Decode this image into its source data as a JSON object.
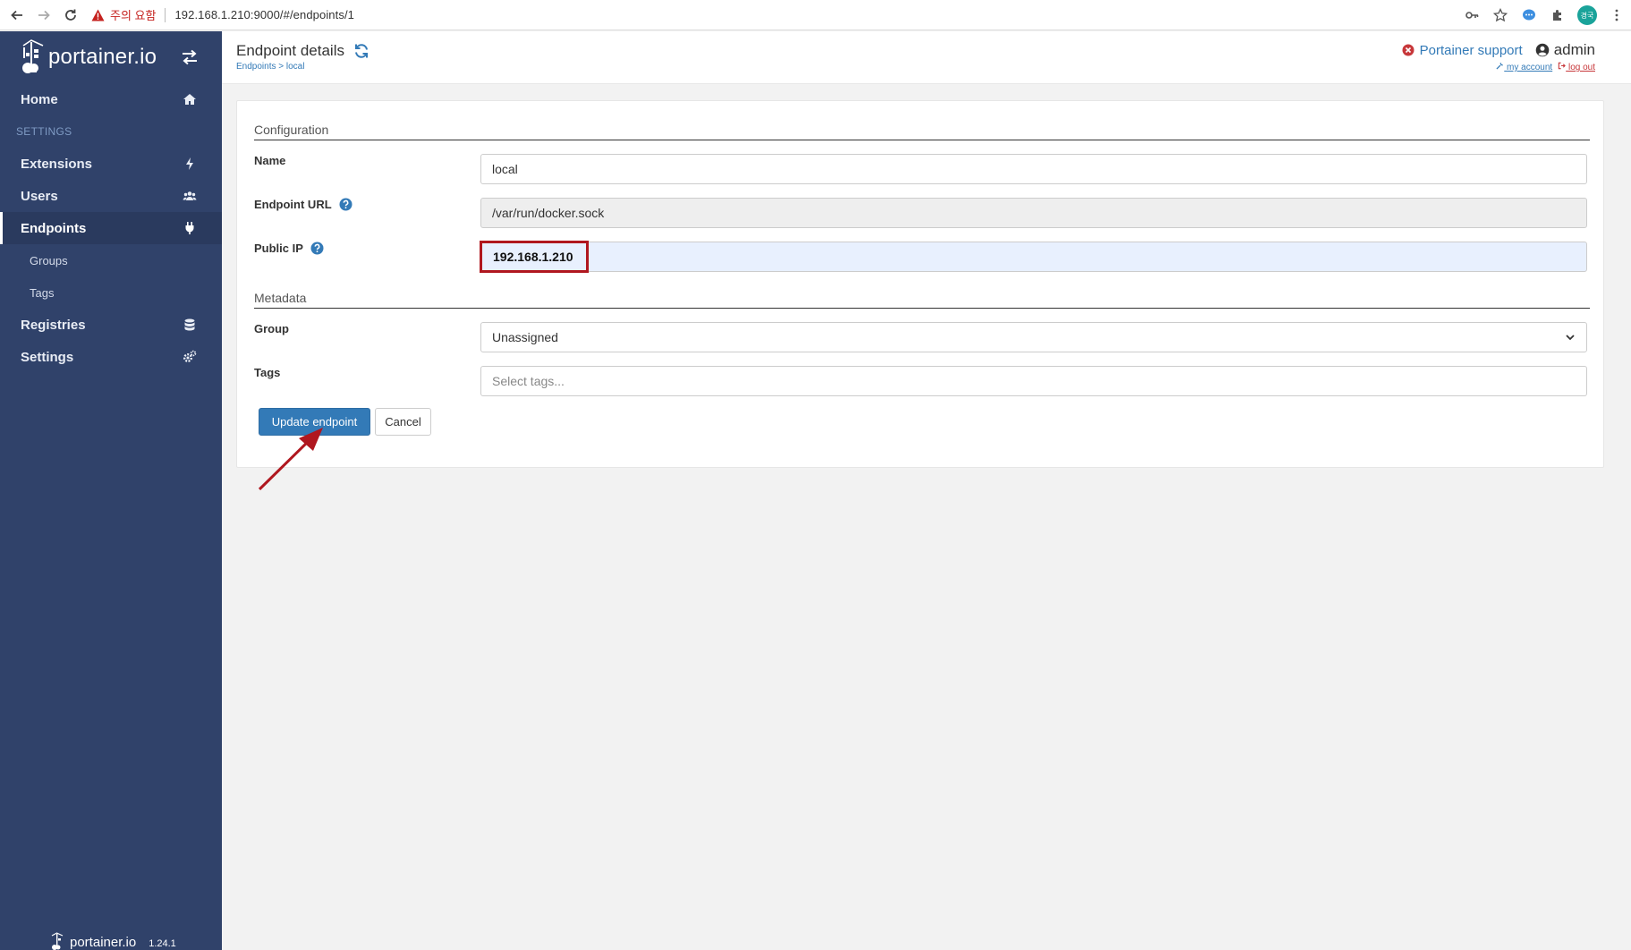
{
  "browser": {
    "warning_text": "주의 요함",
    "url": "192.168.1.210:9000/#/endpoints/1",
    "profile_initials": "경국"
  },
  "sidebar": {
    "logo_text": "portainer.io",
    "items": [
      {
        "label": "Home",
        "icon": "home-icon"
      },
      {
        "label": "Extensions",
        "icon": "bolt-icon"
      },
      {
        "label": "Users",
        "icon": "users-icon"
      },
      {
        "label": "Endpoints",
        "icon": "plug-icon"
      },
      {
        "label": "Registries",
        "icon": "database-icon"
      },
      {
        "label": "Settings",
        "icon": "cogs-icon"
      }
    ],
    "section_settings": "SETTINGS",
    "sub_items": [
      {
        "label": "Groups"
      },
      {
        "label": "Tags"
      }
    ],
    "footer_logo": "portainer.io",
    "version": "1.24.1"
  },
  "header": {
    "title": "Endpoint details",
    "breadcrumb_link": "Endpoints",
    "breadcrumb_sep": " > ",
    "breadcrumb_current": "local",
    "support_label": "Portainer support",
    "user": "admin",
    "my_account": "my account",
    "log_out": "log out"
  },
  "form": {
    "section_configuration": "Configuration",
    "name_label": "Name",
    "name_value": "local",
    "url_label": "Endpoint URL",
    "url_value": "/var/run/docker.sock",
    "public_ip_label": "Public IP",
    "public_ip_value": "192.168.1.210",
    "section_metadata": "Metadata",
    "group_label": "Group",
    "group_value": "Unassigned",
    "tags_label": "Tags",
    "tags_placeholder": "Select tags...",
    "update_button": "Update endpoint",
    "cancel_button": "Cancel"
  },
  "colors": {
    "sidebar_bg": "#30426a",
    "primary": "#337ab7",
    "highlight_annotation": "#b0171f"
  }
}
